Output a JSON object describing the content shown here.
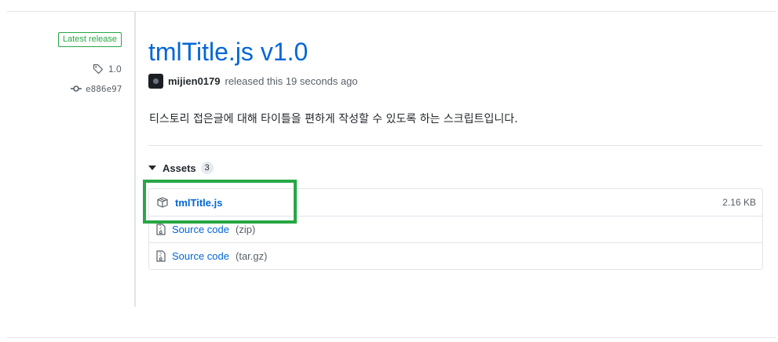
{
  "sidebar": {
    "badge": "Latest release",
    "tag": {
      "label": "1.0",
      "icon": "tag-icon"
    },
    "commit": {
      "label": "e886e97",
      "icon": "git-commit-icon"
    }
  },
  "release": {
    "title": "tmlTitle.js v1.0",
    "author": "mijien0179",
    "meta_suffix": "released this 19 seconds ago",
    "description": "티스토리 접은글에 대해 타이틀을 편하게 작성할 수 있도록 하는 스크립트입니다."
  },
  "assets": {
    "label": "Assets",
    "count": "3",
    "items": [
      {
        "name": "tmlTitle.js",
        "ext": "",
        "size": "2.16 KB",
        "icon": "package-icon"
      },
      {
        "name": "Source code",
        "ext": "(zip)",
        "size": "",
        "icon": "file-zip-icon"
      },
      {
        "name": "Source code",
        "ext": "(tar.gz)",
        "size": "",
        "icon": "file-zip-icon"
      }
    ]
  },
  "colors": {
    "link": "#0366d6",
    "badge_green": "#28a745",
    "highlight_green": "#28a745",
    "muted": "#586069",
    "border": "#e1e4e8"
  }
}
